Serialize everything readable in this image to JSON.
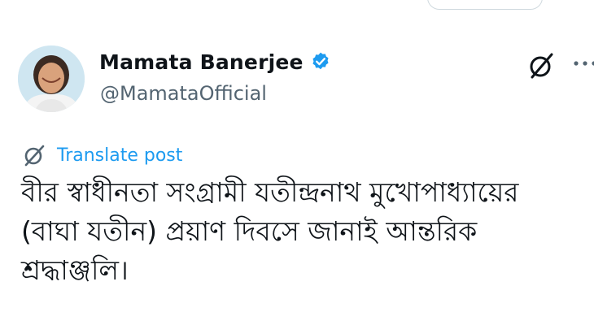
{
  "author": {
    "display_name": "Mamata Banerjee",
    "handle": "@MamataOfficial",
    "verified": true,
    "verified_color": "#1d9bf0"
  },
  "icons": {
    "verified": "verified-badge-icon",
    "grok": "grok-icon",
    "more": "more-options-icon",
    "translate": "translate-icon"
  },
  "translate": {
    "label": "Translate post",
    "color": "#1d9bf0"
  },
  "post": {
    "lines": [
      "বীর স্বাধীনতা সংগ্রামী যতীন্দ্রনাথ মুখোপাধ্যায়ের",
      "(বাঘা যতীন) প্রয়াণ দিবসে জানাই আন্তরিক",
      "শ্রদ্ধাঞ্জলি।"
    ]
  },
  "colors": {
    "text": "#0f1419",
    "secondary": "#536471",
    "background": "#ffffff"
  }
}
